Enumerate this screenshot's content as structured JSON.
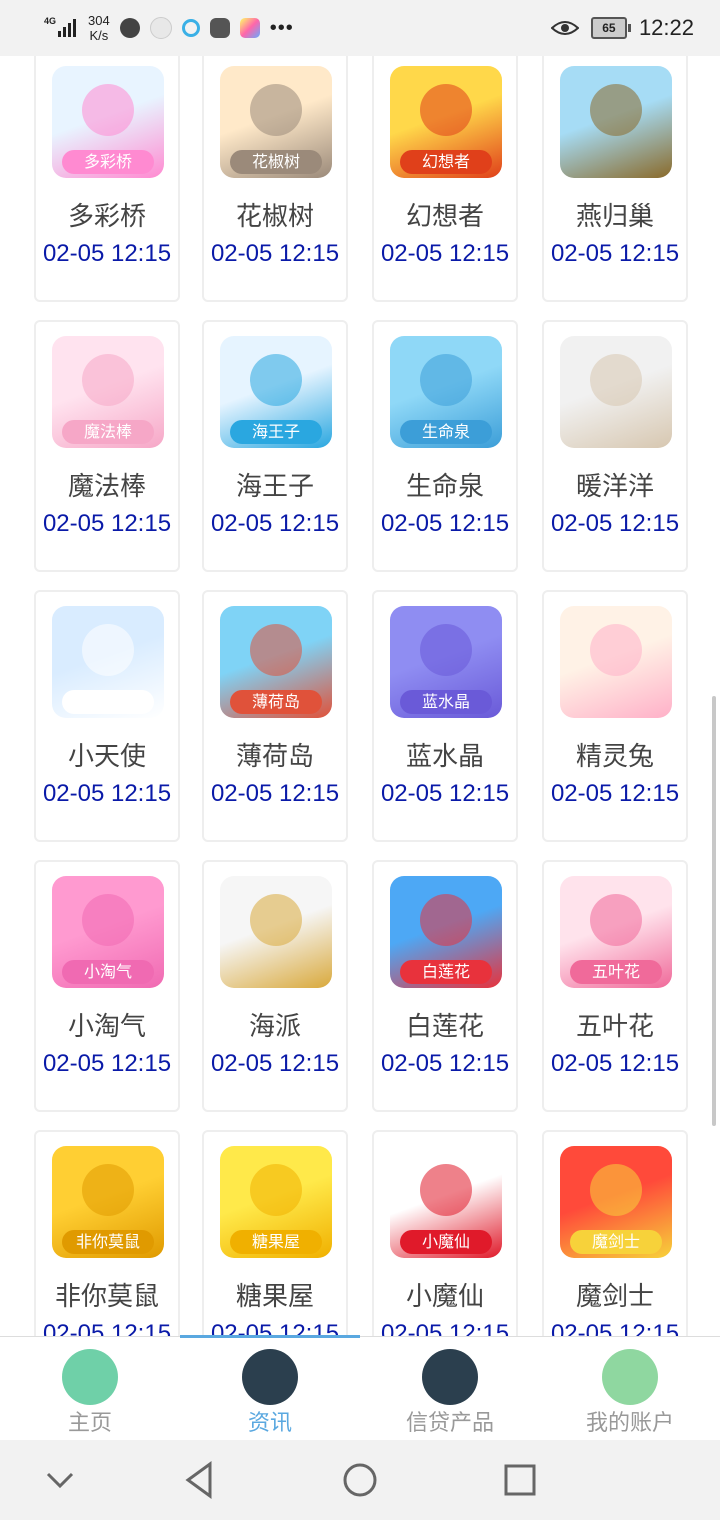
{
  "status_bar": {
    "network": "4G",
    "speed_value": "304",
    "speed_unit": "K/s",
    "battery": "65",
    "time": "12:22"
  },
  "apps": [
    {
      "name": "多彩桥",
      "time": "02-05 12:15",
      "badge": "多彩桥",
      "colors": [
        "#e8f4ff",
        "#ff8ad1"
      ]
    },
    {
      "name": "花椒树",
      "time": "02-05 12:15",
      "badge": "花椒树",
      "colors": [
        "#ffe9c9",
        "#9b8a7a"
      ]
    },
    {
      "name": "幻想者",
      "time": "02-05 12:15",
      "badge": "幻想者",
      "colors": [
        "#ffd84a",
        "#e0401a"
      ]
    },
    {
      "name": "燕归巢",
      "time": "02-05 12:15",
      "badge": "",
      "colors": [
        "#a6dcf5",
        "#8a6a2a"
      ]
    },
    {
      "name": "魔法棒",
      "time": "02-05 12:15",
      "badge": "魔法棒",
      "colors": [
        "#ffe3ef",
        "#f6a7c7"
      ]
    },
    {
      "name": "海王子",
      "time": "02-05 12:15",
      "badge": "海王子",
      "colors": [
        "#e6f4ff",
        "#2aa7e0"
      ]
    },
    {
      "name": "生命泉",
      "time": "02-05 12:15",
      "badge": "生命泉",
      "colors": [
        "#8fd8f7",
        "#3c9ed8"
      ]
    },
    {
      "name": "暖洋洋",
      "time": "02-05 12:15",
      "badge": "",
      "colors": [
        "#f1f1f1",
        "#d7c7b0"
      ]
    },
    {
      "name": "小天使",
      "time": "02-05 12:15",
      "badge": "小天使",
      "colors": [
        "#d9ecff",
        "#ffffff"
      ]
    },
    {
      "name": "薄荷岛",
      "time": "02-05 12:15",
      "badge": "薄荷岛",
      "colors": [
        "#7fd3f6",
        "#e0523a"
      ]
    },
    {
      "name": "蓝水晶",
      "time": "02-05 12:15",
      "badge": "蓝水晶",
      "colors": [
        "#8f8df2",
        "#6a5ad8"
      ]
    },
    {
      "name": "精灵兔",
      "time": "02-05 12:15",
      "badge": "",
      "colors": [
        "#fff2e6",
        "#ffb0c8"
      ]
    },
    {
      "name": "小淘气",
      "time": "02-05 12:15",
      "badge": "小淘气",
      "colors": [
        "#ff9ad0",
        "#f06ab2"
      ]
    },
    {
      "name": "海派",
      "time": "02-05 12:15",
      "badge": "",
      "colors": [
        "#f6f6f6",
        "#d9a93c"
      ]
    },
    {
      "name": "白莲花",
      "time": "02-05 12:15",
      "badge": "白莲花",
      "colors": [
        "#4da8f5",
        "#e8323c"
      ]
    },
    {
      "name": "五叶花",
      "time": "02-05 12:15",
      "badge": "五叶花",
      "colors": [
        "#ffe3ec",
        "#f06a9a"
      ]
    },
    {
      "name": "非你莫鼠",
      "time": "02-05 12:15",
      "badge": "非你莫鼠",
      "colors": [
        "#ffcf33",
        "#e09a00"
      ]
    },
    {
      "name": "糖果屋",
      "time": "02-05 12:15",
      "badge": "糖果屋",
      "colors": [
        "#ffe94a",
        "#f0b000"
      ]
    },
    {
      "name": "小魔仙",
      "time": "02-05 12:15",
      "badge": "小魔仙",
      "colors": [
        "#ffffff",
        "#e01a2a"
      ]
    },
    {
      "name": "魔剑士",
      "time": "02-05 12:15",
      "badge": "魔剑士",
      "colors": [
        "#ff4a3a",
        "#f7d23a"
      ]
    }
  ],
  "tabs": [
    {
      "label": "主页",
      "icon": "home-icon",
      "color": "#6fd0a8"
    },
    {
      "label": "资讯",
      "icon": "money-bag-icon",
      "color": "#2b3f4e"
    },
    {
      "label": "信贷产品",
      "icon": "loan-bag-icon",
      "color": "#2b3f4e"
    },
    {
      "label": "我的账户",
      "icon": "user-avatar-icon",
      "color": "#8fd7a0"
    }
  ],
  "active_tab": 1
}
